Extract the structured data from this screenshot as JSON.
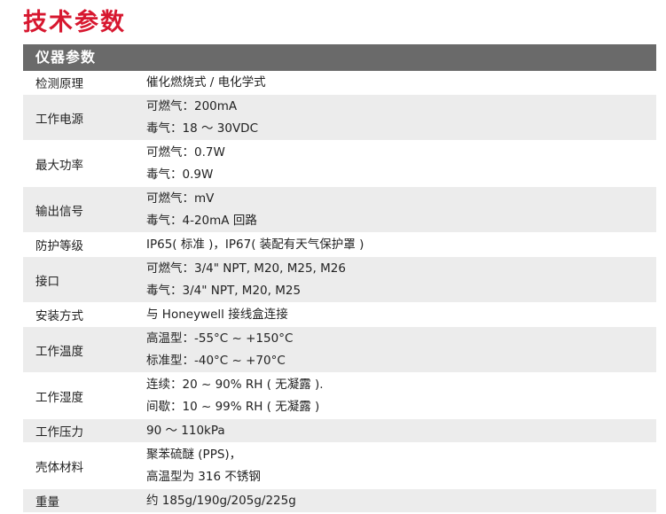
{
  "page_title": "技术参数",
  "section": {
    "title": "仪器参数"
  },
  "rows": [
    {
      "label": "检测原理",
      "lines": [
        "催化燃烧式 / 电化学式"
      ]
    },
    {
      "label": "工作电源",
      "lines": [
        "可燃气：200mA",
        "毒气：18 ～ 30VDC"
      ]
    },
    {
      "label": "最大功率",
      "lines": [
        "可燃气：0.7W",
        "毒气：0.9W"
      ]
    },
    {
      "label": "输出信号",
      "lines": [
        "可燃气：mV",
        "毒气：4-20mA 回路"
      ]
    },
    {
      "label": "防护等级",
      "lines": [
        "IP65( 标准 )，IP67( 装配有天气保护罩 )"
      ]
    },
    {
      "label": "接口",
      "lines": [
        "可燃气：3/4\" NPT, M20, M25, M26",
        "毒气：3/4\" NPT, M20, M25"
      ]
    },
    {
      "label": "安装方式",
      "lines": [
        "与 Honeywell 接线盒连接"
      ]
    },
    {
      "label": "工作温度",
      "lines": [
        "高温型：-55°C ~ +150°C",
        "标准型：-40°C ~ +70°C"
      ]
    },
    {
      "label": "工作湿度",
      "lines": [
        "连续：20 ~ 90% RH ( 无凝露 ).",
        "间歇：10 ~ 99% RH ( 无凝露 )"
      ]
    },
    {
      "label": "工作压力",
      "lines": [
        "90 ～ 110kPa"
      ]
    },
    {
      "label": "壳体材料",
      "lines": [
        "聚苯硫醚 (PPS)，",
        "高温型为 316 不锈钢"
      ]
    },
    {
      "label": "重量",
      "lines": [
        "约 185g/190g/205g/225g"
      ]
    }
  ]
}
